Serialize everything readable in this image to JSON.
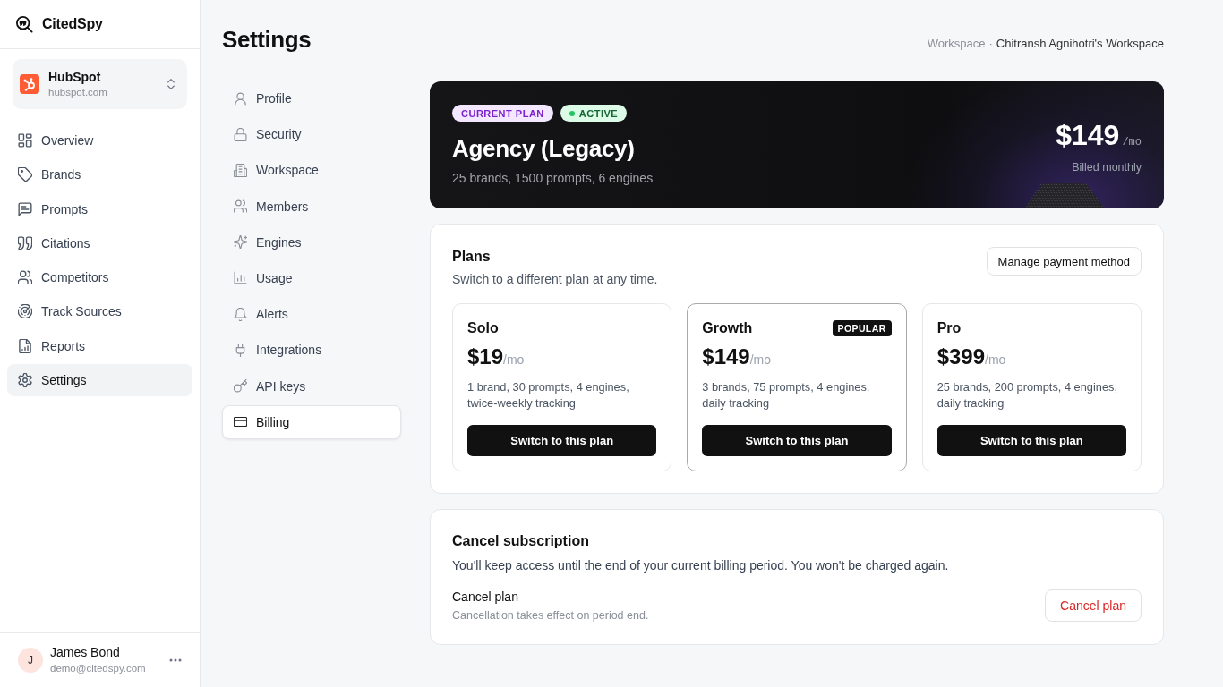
{
  "sidebar": {
    "brand": "CitedSpy",
    "workspace": {
      "name": "HubSpot",
      "domain": "hubspot.com"
    },
    "items": [
      {
        "label": "Overview",
        "selected": false
      },
      {
        "label": "Brands",
        "selected": false
      },
      {
        "label": "Prompts",
        "selected": false
      },
      {
        "label": "Citations",
        "selected": false
      },
      {
        "label": "Competitors",
        "selected": false
      },
      {
        "label": "Track Sources",
        "selected": false
      },
      {
        "label": "Reports",
        "selected": false
      },
      {
        "label": "Settings",
        "selected": true
      }
    ],
    "user": {
      "initial": "J",
      "name": "James Bond",
      "email": "demo@citedspy.com"
    }
  },
  "header": {
    "title": "Settings",
    "breadcrumb": {
      "section": "Workspace",
      "separator": "·",
      "current": "Chitransh Agnihotri's Workspace"
    }
  },
  "settings_nav": {
    "items": [
      {
        "label": "Profile",
        "selected": false
      },
      {
        "label": "Security",
        "selected": false
      },
      {
        "label": "Workspace",
        "selected": false
      },
      {
        "label": "Members",
        "selected": false
      },
      {
        "label": "Engines",
        "selected": false
      },
      {
        "label": "Usage",
        "selected": false
      },
      {
        "label": "Alerts",
        "selected": false
      },
      {
        "label": "Integrations",
        "selected": false
      },
      {
        "label": "API keys",
        "selected": false
      },
      {
        "label": "Billing",
        "selected": true
      }
    ]
  },
  "current_plan": {
    "badges": [
      {
        "label": "CURRENT PLAN",
        "kind": "plan"
      },
      {
        "label": "ACTIVE",
        "kind": "status"
      }
    ],
    "name": "Agency (Legacy)",
    "details": "25 brands, 1500 prompts, 6 engines",
    "price": "$149",
    "period": "/mo",
    "billing": "Billed monthly"
  },
  "plans": {
    "title": "Plans",
    "subtitle": "Switch to a different plan at any time.",
    "action": "Manage payment method",
    "options": [
      {
        "name": "Solo",
        "price": "$19",
        "period": "/mo",
        "features": "1 brand, 30 prompts, 4 engines, twice-weekly tracking",
        "button": "Switch to this plan",
        "highlighted": false
      },
      {
        "name": "Growth",
        "badge": "POPULAR",
        "price": "$149",
        "period": "/mo",
        "features": "3 brands, 75 prompts, 4 engines, daily tracking",
        "button": "Switch to this plan",
        "highlighted": true
      },
      {
        "name": "Pro",
        "price": "$399",
        "period": "/mo",
        "features": "25 brands, 200 prompts, 4 engines, daily tracking",
        "button": "Switch to this plan",
        "highlighted": false
      }
    ]
  },
  "cancel": {
    "title": "Cancel subscription",
    "description": "You'll keep access until the end of your current billing period. You won't be charged again.",
    "label": "Cancel plan",
    "note": "Cancellation takes effect on period end.",
    "button": "Cancel plan"
  }
}
